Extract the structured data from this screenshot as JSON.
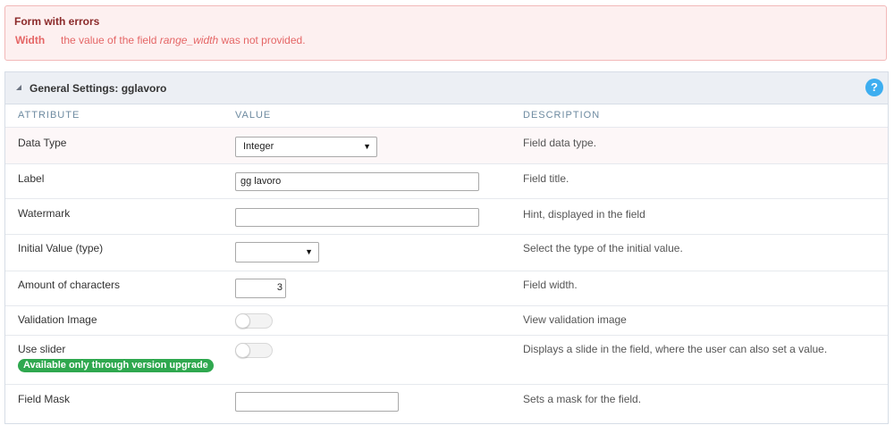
{
  "error": {
    "title": "Form with errors",
    "field": "Width",
    "message_prefix": "the value of the field ",
    "message_field": "range_width",
    "message_suffix": " was not provided."
  },
  "panel": {
    "title": "General Settings: gglavoro",
    "help_label": "?"
  },
  "columns": {
    "attribute": "ATTRIBUTE",
    "value": "VALUE",
    "description": "DESCRIPTION"
  },
  "rows": {
    "data_type": {
      "label": "Data Type",
      "value": "Integer",
      "description": "Field data type."
    },
    "label": {
      "label": "Label",
      "value": "gg lavoro",
      "description": "Field title."
    },
    "watermark": {
      "label": "Watermark",
      "value": "",
      "description": "Hint, displayed in the field"
    },
    "initial_value": {
      "label": "Initial Value (type)",
      "value": "",
      "description": "Select the type of the initial value."
    },
    "amount_chars": {
      "label": "Amount of characters",
      "value": "3",
      "description": "Field width."
    },
    "validation_image": {
      "label": "Validation Image",
      "enabled": false,
      "description": "View validation image"
    },
    "use_slider": {
      "label": "Use slider",
      "enabled": false,
      "badge": "Available only through version upgrade",
      "description": "Displays a slide in the field, where the user can also set a value."
    },
    "field_mask": {
      "label": "Field Mask",
      "value": "",
      "description": "Sets a mask for the field."
    }
  },
  "colors": {
    "error_bg": "#fdf0f0",
    "error_text": "#e56666",
    "help_button": "#3daef0",
    "badge": "#2fa84f",
    "header_bg": "#eceff4"
  }
}
